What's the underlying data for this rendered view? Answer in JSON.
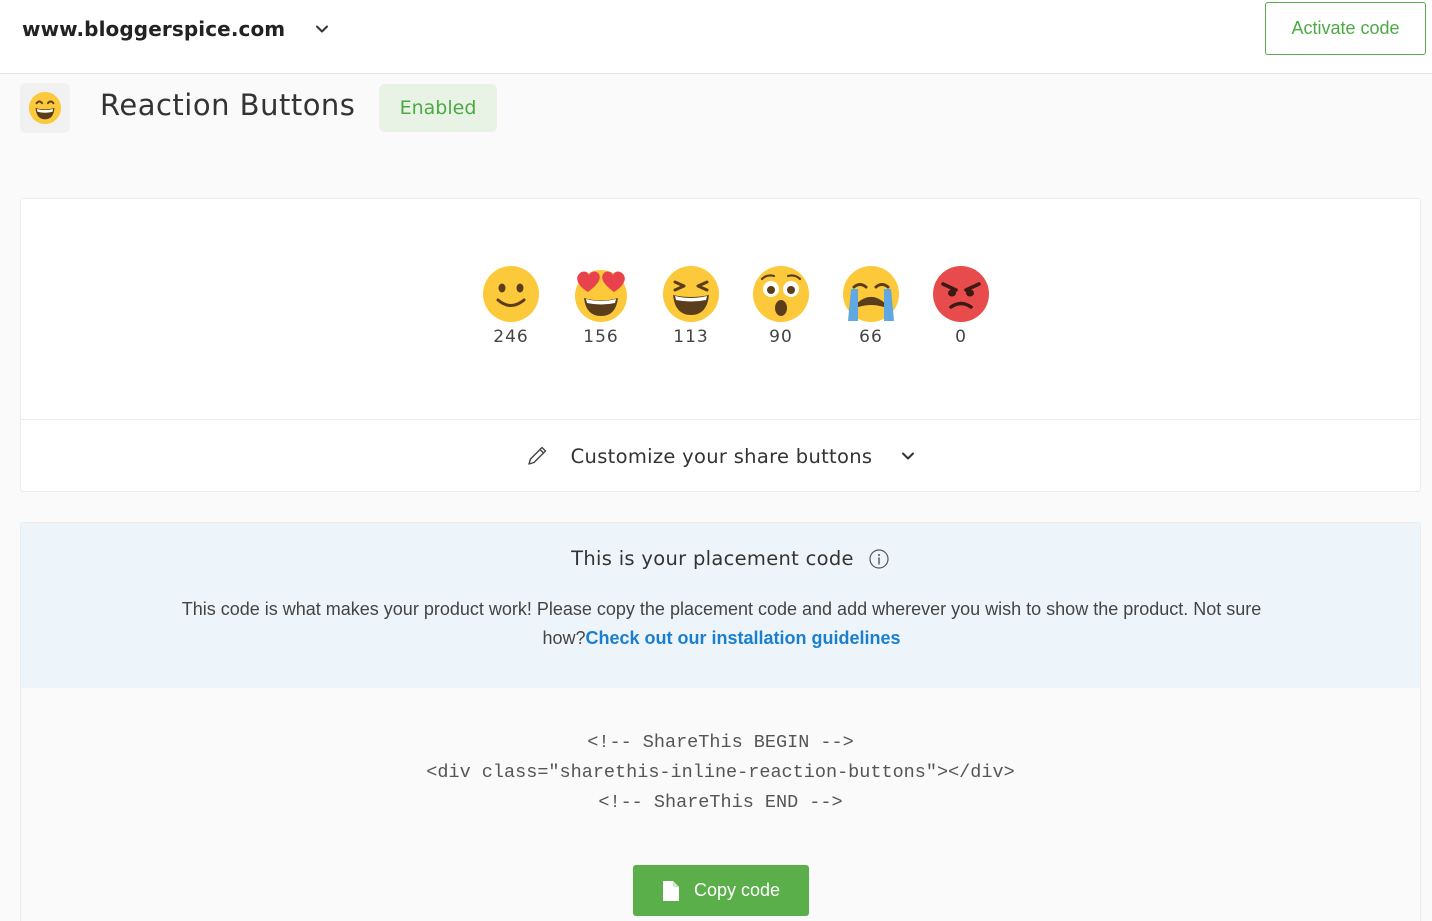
{
  "topbar": {
    "site": "www.bloggerspice.com",
    "activate_label": "Activate code"
  },
  "product": {
    "title": "Reaction Buttons",
    "status": "Enabled",
    "icon": "grinning-emoji-icon"
  },
  "reactions": [
    {
      "icon": "slight-smile-emoji-icon",
      "count": "246"
    },
    {
      "icon": "heart-eyes-emoji-icon",
      "count": "156"
    },
    {
      "icon": "laughing-emoji-icon",
      "count": "113"
    },
    {
      "icon": "astonished-emoji-icon",
      "count": "90"
    },
    {
      "icon": "crying-emoji-icon",
      "count": "66"
    },
    {
      "icon": "angry-emoji-icon",
      "count": "0"
    }
  ],
  "customize": {
    "label": "Customize your share buttons"
  },
  "placement": {
    "title": "This is your placement code",
    "description": "This code is what makes your product work! Please copy the placement code and add wherever you wish to show the product. Not sure how?",
    "link_text": "Check out our installation guidelines",
    "code_lines": [
      "<!-- ShareThis BEGIN -->",
      "<div class=\"sharethis-inline-reaction-buttons\"></div>",
      "<!-- ShareThis END -->"
    ],
    "copy_label": "Copy code"
  },
  "colors": {
    "accent_green": "#5aaf4b",
    "link_blue": "#1a7fd0",
    "emoji_yellow": "#fcc93a",
    "angry_red": "#e84b4b"
  }
}
